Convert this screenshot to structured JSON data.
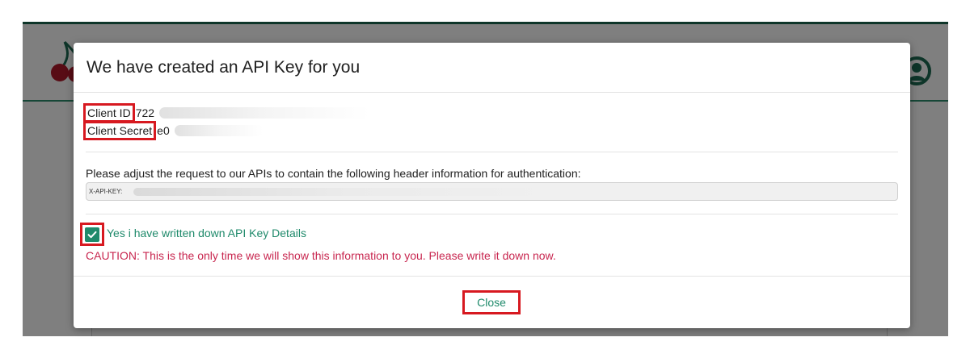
{
  "modal": {
    "title": "We have created an API Key for you",
    "client_id": {
      "label": "Client ID",
      "value": "722"
    },
    "client_secret": {
      "label": "Client Secret",
      "value": "e0"
    },
    "instruction": "Please adjust the request to our APIs to contain the following header information for authentication:",
    "header_field": {
      "label": "X-API-KEY:"
    },
    "confirm_checkbox": {
      "label": "Yes i have written down API Key Details",
      "checked": true
    },
    "caution": "CAUTION: This is the only time we will show this information to you. Please write it down now.",
    "close_label": "Close"
  },
  "colors": {
    "accent": "#1f8a6b",
    "caution": "#c8264f",
    "highlight": "#d71920"
  }
}
